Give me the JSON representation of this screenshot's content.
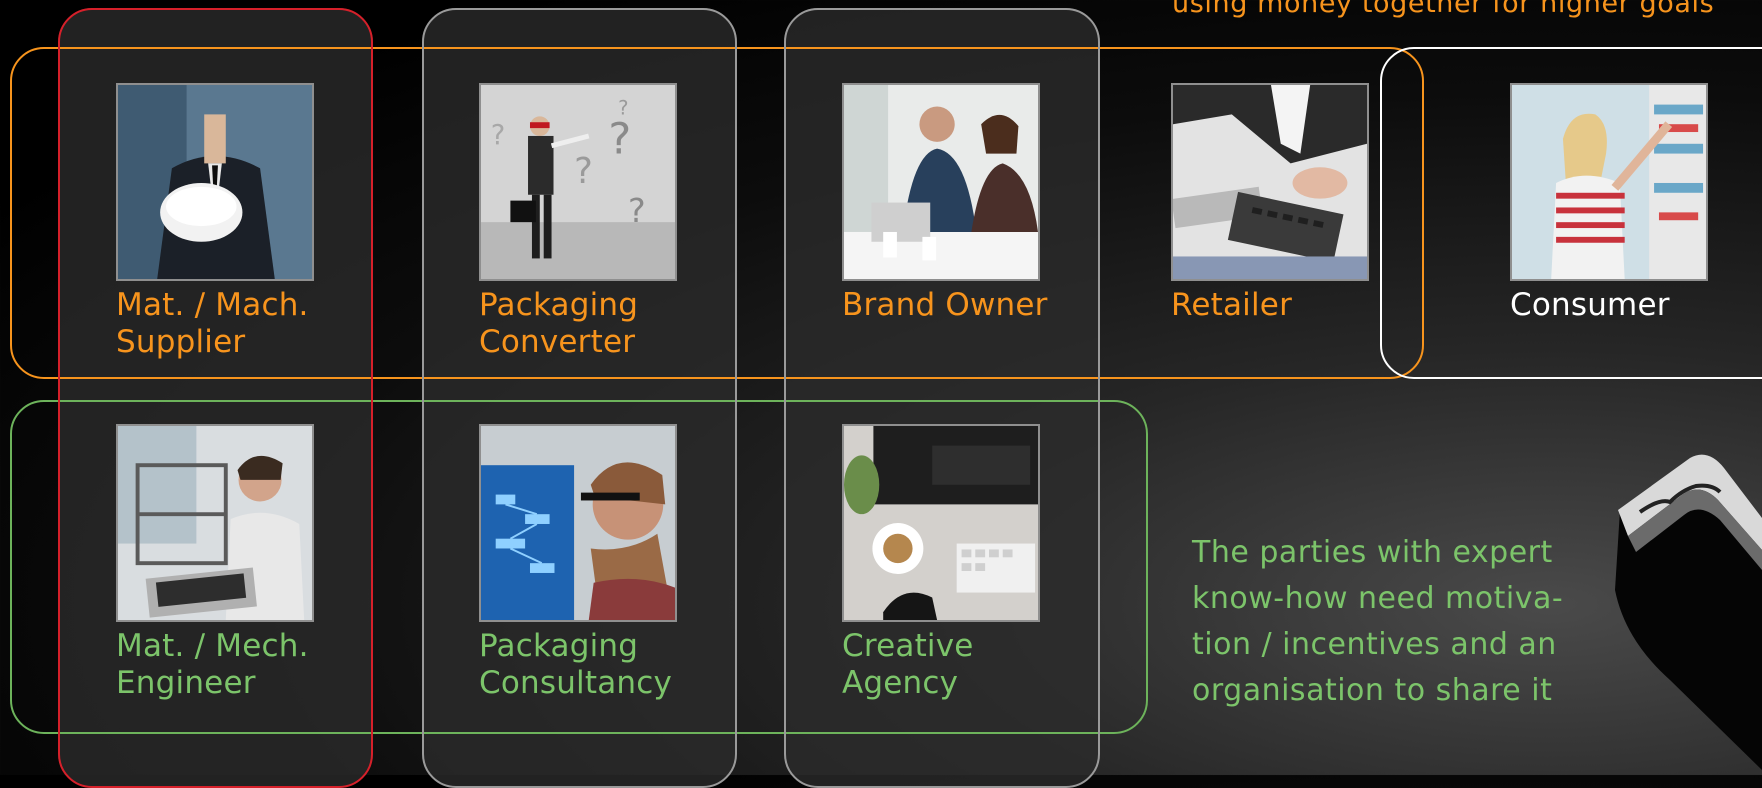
{
  "top_note": "using money together for higher goals",
  "side_note": "The parties with expert\nknow-how need motiva-\ntion / incentives and an\norganisation to share it",
  "upper_row": [
    {
      "label": "Mat. / Mach.\nSupplier",
      "image": "businessman-holding-hard-hat"
    },
    {
      "label": "Packaging\nConverter",
      "image": "blindfolded-man-question-marks"
    },
    {
      "label": "Brand Owner",
      "image": "meeting-at-laptop"
    },
    {
      "label": "Retailer",
      "image": "hands-on-calculator"
    },
    {
      "label": "Consumer",
      "image": "woman-shopping-supermarket"
    }
  ],
  "lower_row": [
    {
      "label": "Mat. / Mech.\nEngineer",
      "image": "engineer-with-3d-printer"
    },
    {
      "label": "Packaging\nConsultancy",
      "image": "man-at-computer-screen"
    },
    {
      "label": "Creative\nAgency",
      "image": "desk-with-coffee-keyboard"
    }
  ],
  "colors": {
    "orange": "#f7941d",
    "green": "#7cc46a",
    "red": "#d6202a",
    "grey": "#9a9a9a",
    "white": "#ffffff"
  }
}
